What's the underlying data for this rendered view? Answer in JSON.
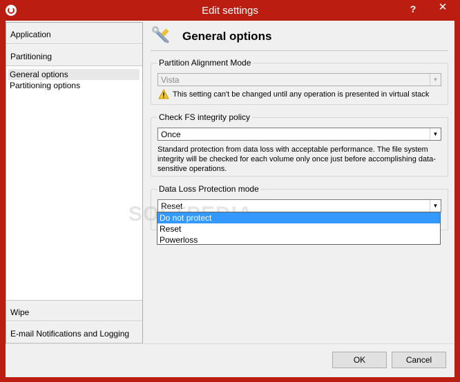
{
  "window": {
    "title": "Edit settings",
    "help_button": "?",
    "close_button": "✕",
    "accent_color": "#bb1e10"
  },
  "nav": {
    "categories": [
      {
        "label": "Application"
      },
      {
        "label": "Partitioning"
      },
      {
        "label": "Wipe"
      },
      {
        "label": "E-mail Notifications and Logging"
      }
    ],
    "partitioning_items": [
      {
        "label": "General options",
        "selected": true
      },
      {
        "label": "Partitioning options",
        "selected": false
      }
    ]
  },
  "header": {
    "title": "General options",
    "icon": "wrench-screwdriver-icon"
  },
  "partition_alignment": {
    "title": "Partition Alignment Mode",
    "value": "Vista",
    "enabled": false,
    "warning": "This setting can't be changed until any operation is presented in virtual stack",
    "warning_icon": "warning-icon"
  },
  "fs_integrity": {
    "title": "Check FS integrity policy",
    "value": "Once",
    "description": "Standard protection from data loss with acceptable performance. The file system integrity will be checked for each volume only once just before accomplishing data-sensitive operations."
  },
  "data_loss": {
    "title": "Data Loss Protection mode",
    "value": "Reset",
    "options": [
      {
        "label": "Do not protect",
        "highlighted": true
      },
      {
        "label": "Reset",
        "highlighted": false
      },
      {
        "label": "Powerloss",
        "highlighted": false
      }
    ]
  },
  "buttons": {
    "ok": "OK",
    "cancel": "Cancel"
  },
  "watermark": "SOFTPEDIA"
}
